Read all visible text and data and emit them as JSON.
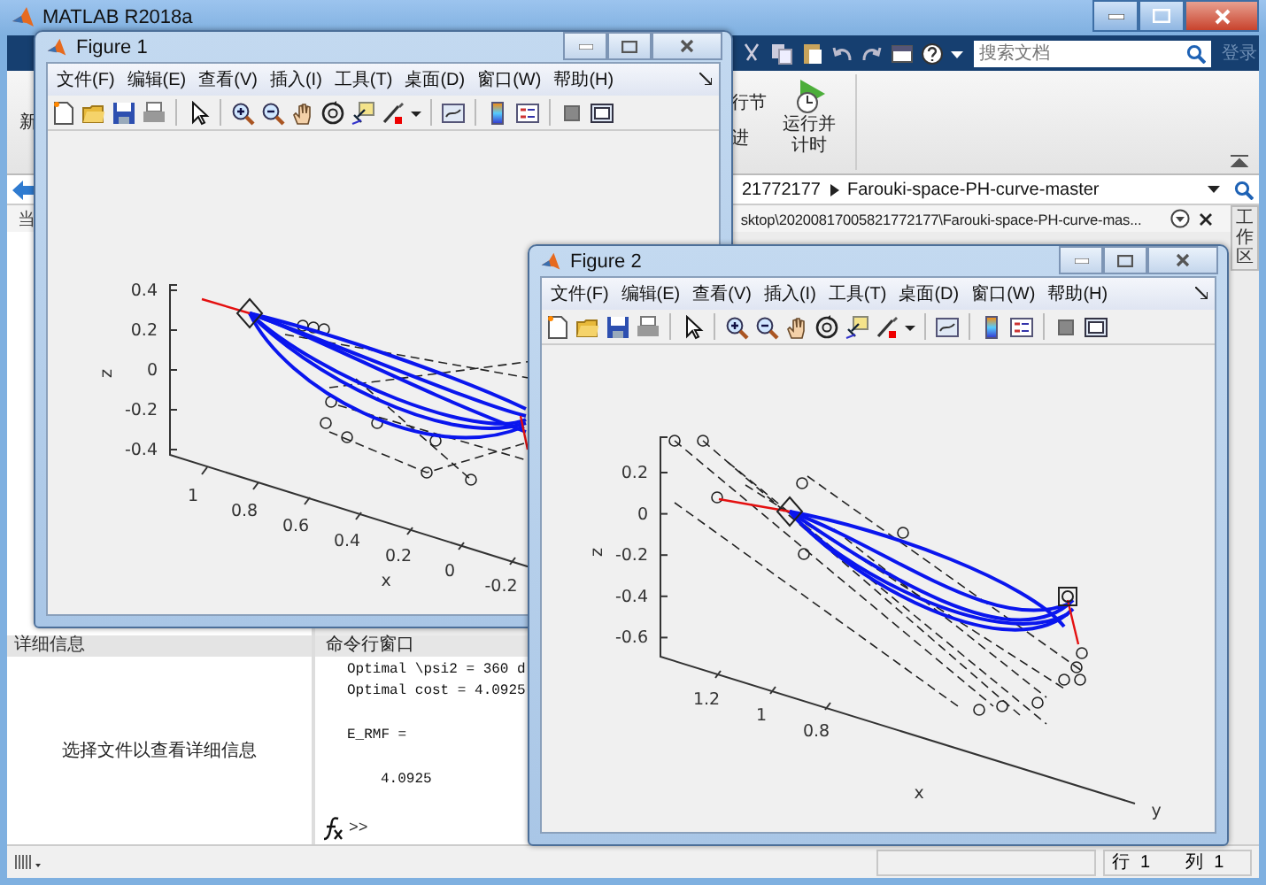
{
  "window": {
    "title": "MATLAB R2018a"
  },
  "search": {
    "placeholder": "搜索文档"
  },
  "sign_in": "登录",
  "ribbon": {
    "partial_labels": [
      "新",
      "行节",
      "进"
    ],
    "run_and_time_button": "运行并计时"
  },
  "address_bar": {
    "crumbs": [
      "21772177",
      "Farouki-space-PH-curve-master"
    ]
  },
  "current_path": {
    "panel_title": "当",
    "path": "sktop\\20200817005821772177\\Farouki-space-PH-curve-mas..."
  },
  "workspace_panel": {
    "title": "工作区"
  },
  "details_panel": {
    "title": "详细信息",
    "message": "选择文件以查看详细信息"
  },
  "command_window": {
    "title": "命令行窗口",
    "prompt": ">>",
    "blocks": [
      {
        "kind": "output",
        "lines": [
          "Optimal \\psi2 = 360 d",
          "Optimal cost = 4.0925"
        ]
      },
      {
        "kind": "output",
        "lines": [
          "E_RMF ="
        ]
      },
      {
        "kind": "value",
        "lines": [
          "4.0925"
        ]
      }
    ]
  },
  "status_bar": {
    "row_label": "行",
    "row": "1",
    "col_label": "列",
    "col": "1"
  },
  "figures": [
    {
      "title": "Figure 1",
      "menu": [
        "文件(F)",
        "编辑(E)",
        "查看(V)",
        "插入(I)",
        "工具(T)",
        "桌面(D)",
        "窗口(W)",
        "帮助(H)"
      ],
      "plot": {
        "z_label": "z",
        "z_ticks": [
          "0.4",
          "0.2",
          "0",
          "-0.2",
          "-0.4"
        ],
        "x_label": "x",
        "x_ticks": [
          "1",
          "0.8",
          "0.6",
          "0.4",
          "0.2",
          "0",
          "-0.2"
        ]
      }
    },
    {
      "title": "Figure 2",
      "menu": [
        "文件(F)",
        "编辑(E)",
        "查看(V)",
        "插入(I)",
        "工具(T)",
        "桌面(D)",
        "窗口(W)",
        "帮助(H)"
      ],
      "plot": {
        "z_label": "z",
        "z_ticks": [
          "0.2",
          "0",
          "-0.2",
          "-0.4",
          "-0.6"
        ],
        "x_label": "x",
        "x_ticks": [
          "1.2",
          "1",
          "0.8"
        ],
        "y_label": "y"
      }
    }
  ]
}
